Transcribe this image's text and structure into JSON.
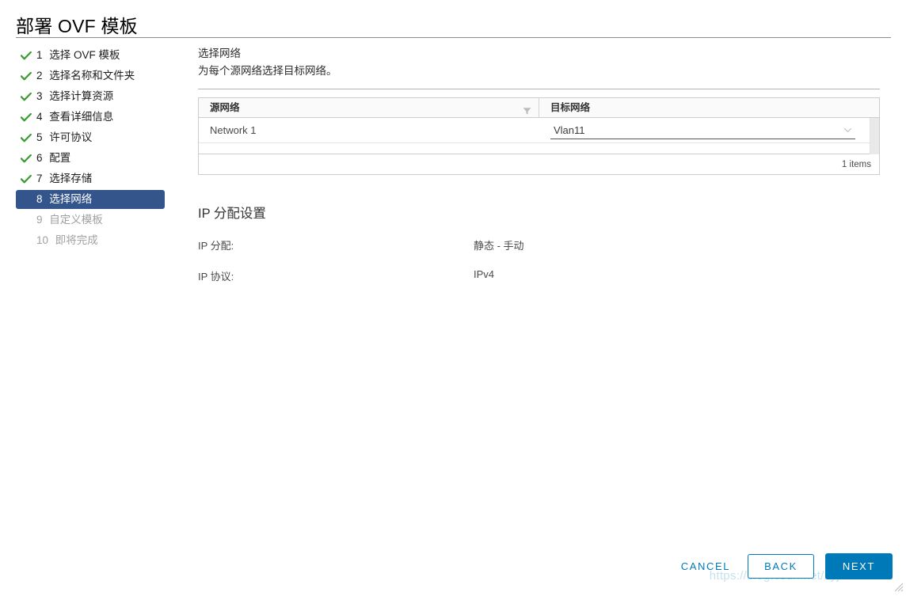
{
  "dialog": {
    "title": "部署 OVF 模板"
  },
  "wizard": {
    "steps": [
      {
        "num": "1",
        "label": "选择 OVF 模板",
        "state": "done"
      },
      {
        "num": "2",
        "label": "选择名称和文件夹",
        "state": "done"
      },
      {
        "num": "3",
        "label": "选择计算资源",
        "state": "done"
      },
      {
        "num": "4",
        "label": "查看详细信息",
        "state": "done"
      },
      {
        "num": "5",
        "label": "许可协议",
        "state": "done"
      },
      {
        "num": "6",
        "label": "配置",
        "state": "done"
      },
      {
        "num": "7",
        "label": "选择存储",
        "state": "done"
      },
      {
        "num": "8",
        "label": "选择网络",
        "state": "current"
      },
      {
        "num": "9",
        "label": "自定义模板",
        "state": "pending"
      },
      {
        "num": "10",
        "label": "即将完成",
        "state": "pending"
      }
    ]
  },
  "content": {
    "heading": "选择网络",
    "subheading": "为每个源网络选择目标网络。",
    "table": {
      "columns": [
        "源网络",
        "目标网络"
      ],
      "rows": [
        {
          "source": "Network 1",
          "target": "Vlan11"
        }
      ],
      "footer_count": "1 items"
    },
    "ip_settings": {
      "title": "IP 分配设置",
      "rows": [
        {
          "label": "IP 分配:",
          "value": "静态 - 手动"
        },
        {
          "label": "IP 协议:",
          "value": "IPv4"
        }
      ]
    }
  },
  "footer": {
    "cancel_label": "CANCEL",
    "back_label": "BACK",
    "next_label": "NEXT"
  },
  "watermark": {
    "text": "https://blog.csdn.net/zyj81092211"
  },
  "colors": {
    "accent": "#0079b8",
    "step_selected_bg": "#34558b",
    "check_green": "#3f9c35",
    "watermark": "#b9dced"
  }
}
